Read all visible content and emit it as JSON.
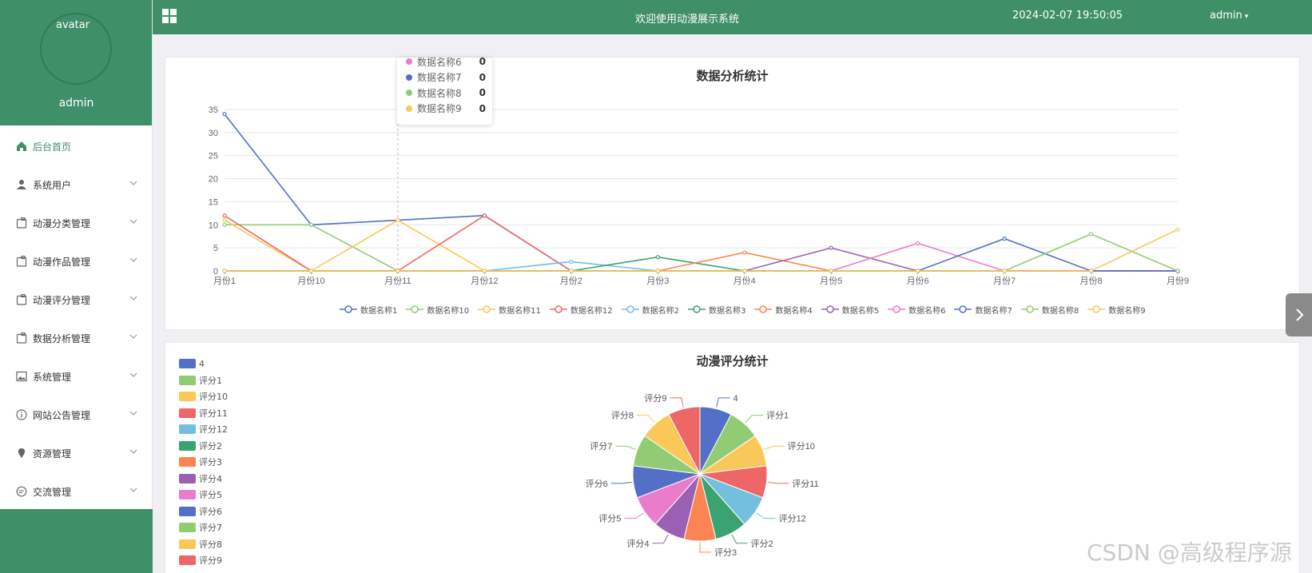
{
  "sidebar": {
    "avatar_alt": "avatar",
    "username": "admin",
    "items": [
      {
        "label": "后台首页",
        "icon": "home-icon",
        "active": true,
        "has_submenu": false
      },
      {
        "label": "系统用户",
        "icon": "user-icon",
        "has_submenu": true
      },
      {
        "label": "动漫分类管理",
        "icon": "clipboard-icon",
        "has_submenu": true
      },
      {
        "label": "动漫作品管理",
        "icon": "clipboard-icon",
        "has_submenu": true
      },
      {
        "label": "动漫评分管理",
        "icon": "clipboard-icon",
        "has_submenu": true
      },
      {
        "label": "数据分析管理",
        "icon": "clipboard-icon",
        "has_submenu": true
      },
      {
        "label": "系统管理",
        "icon": "picture-icon",
        "has_submenu": true
      },
      {
        "label": "网站公告管理",
        "icon": "info-icon",
        "has_submenu": true
      },
      {
        "label": "资源管理",
        "icon": "location-icon",
        "has_submenu": true
      },
      {
        "label": "交流管理",
        "icon": "chat-icon",
        "has_submenu": true
      }
    ]
  },
  "header": {
    "title": "欢迎使用动漫展示系统",
    "datetime": "2024-02-07 19:50:05",
    "user": "admin"
  },
  "colors": {
    "primary": "#3f8f69",
    "palette": [
      "#5470c6",
      "#91cc75",
      "#fac858",
      "#ee6666",
      "#73c0de",
      "#3ba272",
      "#fc8452",
      "#9a60b4",
      "#ea7ccc"
    ]
  },
  "tooltip": {
    "items": [
      {
        "name": "数据名称6",
        "value": "0",
        "color": "#ea7ccc"
      },
      {
        "name": "数据名称7",
        "value": "0",
        "color": "#5470c6"
      },
      {
        "name": "数据名称8",
        "value": "0",
        "color": "#91cc75"
      },
      {
        "name": "数据名称9",
        "value": "0",
        "color": "#fac858"
      }
    ]
  },
  "chart_data": [
    {
      "type": "line",
      "title": "数据分析统计",
      "categories": [
        "月份1",
        "月份10",
        "月份11",
        "月份12",
        "月份2",
        "月份3",
        "月份4",
        "月份5",
        "月份6",
        "月份7",
        "月份8",
        "月份9"
      ],
      "ylim": [
        0,
        35
      ],
      "yticks": [
        0,
        5,
        10,
        15,
        20,
        25,
        30,
        35
      ],
      "grid": true,
      "legend_position": "bottom",
      "series": [
        {
          "name": "数据名称1",
          "color": "#5470c6",
          "values": [
            34,
            10,
            11,
            12,
            0,
            0,
            0,
            0,
            0,
            0,
            0,
            0
          ]
        },
        {
          "name": "数据名称10",
          "color": "#91cc75",
          "values": [
            10,
            10,
            0,
            0,
            0,
            0,
            0,
            0,
            0,
            0,
            0,
            0
          ]
        },
        {
          "name": "数据名称11",
          "color": "#fac858",
          "values": [
            11,
            0,
            11,
            0,
            0,
            0,
            0,
            0,
            0,
            0,
            0,
            0
          ]
        },
        {
          "name": "数据名称12",
          "color": "#ee6666",
          "values": [
            12,
            0,
            0,
            12,
            0,
            0,
            0,
            0,
            0,
            0,
            0,
            0
          ]
        },
        {
          "name": "数据名称2",
          "color": "#73c0de",
          "values": [
            0,
            0,
            0,
            0,
            2,
            0,
            0,
            0,
            0,
            0,
            0,
            0
          ]
        },
        {
          "name": "数据名称3",
          "color": "#3ba272",
          "values": [
            0,
            0,
            0,
            0,
            0,
            3,
            0,
            0,
            0,
            0,
            0,
            0
          ]
        },
        {
          "name": "数据名称4",
          "color": "#fc8452",
          "values": [
            0,
            0,
            0,
            0,
            0,
            0,
            4,
            0,
            0,
            0,
            0,
            0
          ]
        },
        {
          "name": "数据名称5",
          "color": "#9a60b4",
          "values": [
            0,
            0,
            0,
            0,
            0,
            0,
            0,
            5,
            0,
            0,
            0,
            0
          ]
        },
        {
          "name": "数据名称6",
          "color": "#ea7ccc",
          "values": [
            0,
            0,
            0,
            0,
            0,
            0,
            0,
            0,
            6,
            0,
            0,
            0
          ]
        },
        {
          "name": "数据名称7",
          "color": "#5470c6",
          "values": [
            0,
            0,
            0,
            0,
            0,
            0,
            0,
            0,
            0,
            7,
            0,
            0
          ]
        },
        {
          "name": "数据名称8",
          "color": "#91cc75",
          "values": [
            0,
            0,
            0,
            0,
            0,
            0,
            0,
            0,
            0,
            0,
            8,
            0
          ]
        },
        {
          "name": "数据名称9",
          "color": "#fac858",
          "values": [
            0,
            0,
            0,
            0,
            0,
            0,
            0,
            0,
            0,
            0,
            0,
            9
          ]
        }
      ]
    },
    {
      "type": "pie",
      "title": "动漫评分统计",
      "legend_position": "top-left",
      "slices": [
        {
          "label": "4",
          "value": 1,
          "color": "#5470c6"
        },
        {
          "label": "评分1",
          "value": 1,
          "color": "#91cc75"
        },
        {
          "label": "评分10",
          "value": 1,
          "color": "#fac858"
        },
        {
          "label": "评分11",
          "value": 1,
          "color": "#ee6666"
        },
        {
          "label": "评分12",
          "value": 1,
          "color": "#73c0de"
        },
        {
          "label": "评分2",
          "value": 1,
          "color": "#3ba272"
        },
        {
          "label": "评分3",
          "value": 1,
          "color": "#fc8452"
        },
        {
          "label": "评分4",
          "value": 1,
          "color": "#9a60b4"
        },
        {
          "label": "评分5",
          "value": 1,
          "color": "#ea7ccc"
        },
        {
          "label": "评分6",
          "value": 1,
          "color": "#5470c6"
        },
        {
          "label": "评分7",
          "value": 1,
          "color": "#91cc75"
        },
        {
          "label": "评分8",
          "value": 1,
          "color": "#fac858"
        },
        {
          "label": "评分9",
          "value": 1,
          "color": "#ee6666"
        }
      ]
    }
  ],
  "watermark": "CSDN @高级程序源"
}
